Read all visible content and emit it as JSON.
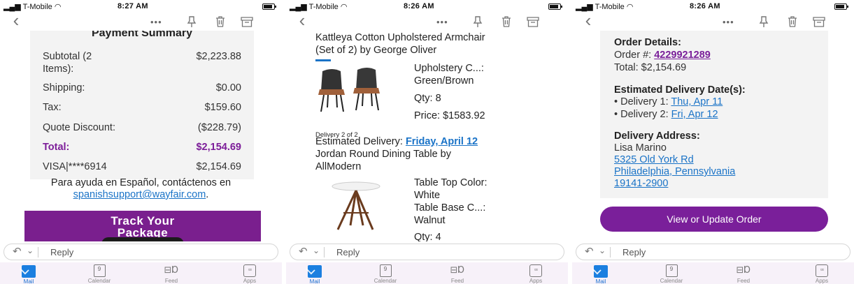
{
  "status_bars": [
    {
      "carrier": "T-Mobile",
      "time": "8:27 AM"
    },
    {
      "carrier": "T-Mobile",
      "time": "8:26 AM"
    },
    {
      "carrier": "T-Mobile",
      "time": "8:26 AM"
    }
  ],
  "toolbar": {
    "back_icon": "chevron-left-icon",
    "more_label": "•••",
    "pin_icon": "pin-icon",
    "trash_icon": "trash-icon",
    "archive_icon": "archive-icon"
  },
  "reply": {
    "label": "Reply"
  },
  "tabs": [
    {
      "label": "Mail",
      "icon": "mail-icon",
      "active": true
    },
    {
      "label": "Calendar",
      "icon": "calendar-icon",
      "badge": "9"
    },
    {
      "label": "Feed",
      "icon": "feed-icon"
    },
    {
      "label": "Apps",
      "icon": "apps-icon"
    }
  ],
  "panel1": {
    "heading": "Payment Summary",
    "rows": [
      {
        "label": "Subtotal (2",
        "label2": "Items):",
        "value": "$2,223.88"
      },
      {
        "label": "Shipping:",
        "value": "$0.00"
      },
      {
        "label": "Tax:",
        "value": "$159.60"
      },
      {
        "label": "Quote Discount:",
        "value": "($228.79)"
      },
      {
        "label": "Total:",
        "value": "$2,154.69"
      },
      {
        "label": "VISA|****6914",
        "value": "$2,154.69"
      }
    ],
    "spanish_text": "Para ayuda en Español, contáctenos en",
    "spanish_email": "spanishsupport@wayfair.com",
    "spanish_period": ".",
    "promo_line1": "Track Your",
    "promo_line2": "Package"
  },
  "panel2": {
    "item1_title_line1": "Kattleya Cotton Upholstered Armchair",
    "item1_title_line2": "(Set of 2) by George Oliver",
    "item1_attr_label": "Upholstery C...:",
    "item1_attr_value": "Green/Brown",
    "item1_qty": "Qty: 8",
    "item1_price": "Price: $1583.92",
    "delivery_counter": "Delivery 2 of 2",
    "estimated_label": "Estimated Delivery: ",
    "estimated_date": "Friday, April 12",
    "item2_title_line1": "Jordan Round Dining Table by",
    "item2_title_line2": "AllModern",
    "item2_attr1_label": "Table Top Color:",
    "item2_attr1_value": "White",
    "item2_attr2_label": "Table Base C...:",
    "item2_attr2_value": "Walnut",
    "item2_qty": "Qty: 4"
  },
  "panel3": {
    "order_details_heading": "Order Details:",
    "order_label": "Order #: ",
    "order_number": "4229921289",
    "total": "Total: $2,154.69",
    "delivery_heading": "Estimated Delivery Date(s):",
    "delivery1_label": "• Delivery 1: ",
    "delivery1_date": "Thu, Apr 11",
    "delivery2_label": "• Delivery 2: ",
    "delivery2_date": "Fri, Apr 12",
    "address_heading": "Delivery Address:",
    "name": "Lisa Marino",
    "address_line1": "5325 Old York Rd",
    "address_line2": "Philadelphia, Pennsylvania",
    "address_line3": "19141-2900",
    "button_label": "View or Update Order"
  },
  "colors": {
    "accent_purple": "#7a1f9a",
    "link_blue": "#1a73c7",
    "mail_blue": "#1b7fe0"
  }
}
